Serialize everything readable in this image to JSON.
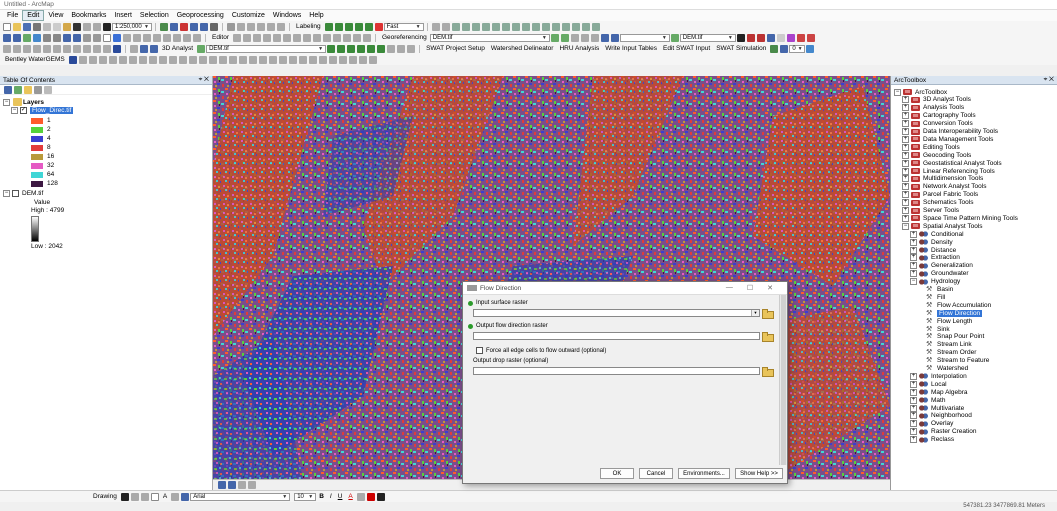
{
  "window": {
    "title": "Untitled - ArcMap"
  },
  "menu": [
    "File",
    "Edit",
    "View",
    "Bookmarks",
    "Insert",
    "Selection",
    "Geoprocessing",
    "Customize",
    "Windows",
    "Help"
  ],
  "toolbar": {
    "scale": "1:250,000",
    "labeling": "Labeling",
    "fast": "Fast",
    "georeferencing": "Georeferencing",
    "georef_layer": "DEM.tif",
    "editor": "Editor",
    "spatial_layer": "DEM.tif",
    "analyst3d": "3D Analyst",
    "analyst3d_layer": "DEM.tif",
    "swat_project": "SWAT Project Setup",
    "watershed": "Watershed Delineator",
    "hru": "HRU Analysis",
    "write_input": "Write Input Tables",
    "edit_swat": "Edit SWAT Input",
    "swat_sim": "SWAT Simulation",
    "bentley": "Bentley WaterGEMS",
    "zoom_value": "0"
  },
  "toc": {
    "title": "Table Of Contents",
    "layers_label": "Layers",
    "layer1": "Flow_Direc.tif",
    "legend": [
      {
        "label": "1",
        "color": "#ff5b2b"
      },
      {
        "label": "2",
        "color": "#56d23a"
      },
      {
        "label": "4",
        "color": "#3b3fd1"
      },
      {
        "label": "8",
        "color": "#e23b3b"
      },
      {
        "label": "16",
        "color": "#b99a3a"
      },
      {
        "label": "32",
        "color": "#e55ac4"
      },
      {
        "label": "64",
        "color": "#3fd6d6"
      },
      {
        "label": "128",
        "color": "#3d1842"
      }
    ],
    "layer2": "DEM.tif",
    "value_label": "Value",
    "high": "High : 4799",
    "low": "Low : 2042"
  },
  "arctoolbox": {
    "title": "ArcToolbox",
    "root": "ArcToolbox",
    "toolboxes": [
      "3D Analyst Tools",
      "Analysis Tools",
      "Cartography Tools",
      "Conversion Tools",
      "Data Interoperability Tools",
      "Data Management Tools",
      "Editing Tools",
      "Geocoding Tools",
      "Geostatistical Analyst Tools",
      "Linear Referencing Tools",
      "Multidimension Tools",
      "Network Analyst Tools",
      "Parcel Fabric Tools",
      "Schematics Tools",
      "Server Tools",
      "Space Time Pattern Mining Tools",
      "Spatial Analyst Tools"
    ],
    "spatial_sets_before": [
      "Conditional",
      "Density",
      "Distance",
      "Extraction",
      "Generalization",
      "Groundwater",
      "Hydrology"
    ],
    "hydrology_tools": [
      "Basin",
      "Fill",
      "Flow Accumulation",
      "Flow Direction",
      "Flow Length",
      "Sink",
      "Snap Pour Point",
      "Stream Link",
      "Stream Order",
      "Stream to Feature",
      "Watershed"
    ],
    "spatial_sets_after": [
      "Interpolation",
      "Local",
      "Map Algebra",
      "Math",
      "Multivariate",
      "Neighborhood",
      "Overlay",
      "Raster Creation",
      "Reclass"
    ]
  },
  "dialog": {
    "title": "Flow Direction",
    "input_label": "Input surface raster",
    "output_label": "Output flow direction raster",
    "force_label": "Force all edge cells to flow outward (optional)",
    "drop_label": "Output drop raster (optional)",
    "ok": "OK",
    "cancel": "Cancel",
    "environments": "Environments...",
    "help": "Show Help >>"
  },
  "drawbar": {
    "drawing": "Drawing",
    "font": "Arial",
    "size": "10",
    "bold": "B",
    "italic": "I",
    "underline": "U",
    "font_color": "A"
  },
  "status": {
    "coords": "547381.23  3477869.81 Meters"
  }
}
